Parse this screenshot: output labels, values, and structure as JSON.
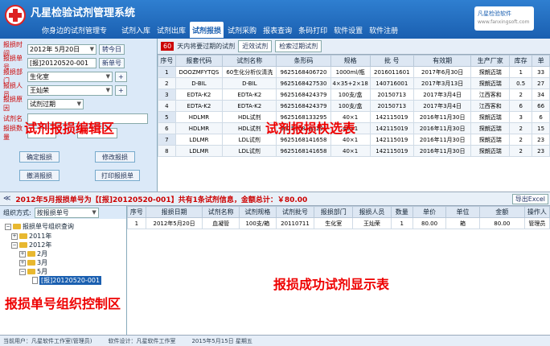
{
  "header": {
    "title": "凡星检验试剂管理系统",
    "subtitle": "你身边的试剂管理专",
    "nav": [
      "试剂入库",
      "试剂出库",
      "试剂报损",
      "试剂采购",
      "报表查询",
      "条码打印",
      "软件设置",
      "软件注册"
    ],
    "active_index": 2,
    "brand_line1": "凡星检验软件",
    "brand_line2": "www.fanxingsoft.com"
  },
  "edit_form": {
    "date_label": "报损时间",
    "date_value": "2012年 5月20日",
    "today_btn": "转今日",
    "number_label": "报损单号",
    "number_value": "[报]20120520-001",
    "new_btn": "新单号",
    "dept_label": "报损部门",
    "dept_value": "生化室",
    "person_label": "报损人员",
    "person_value": "王灿荣",
    "reason_label": "报损原因",
    "reason_value": "试剂过期",
    "item_label": "试剂名",
    "qty_label": "报损数量",
    "confirm_btn": "确定报损",
    "modify_btn": "修改报损",
    "cancel_btn": "撤消报损",
    "print_btn": "打印报损单"
  },
  "quick": {
    "badge": "60",
    "hint": "天内将要过期的试剂",
    "recent_btn": "近效试剂",
    "expired_btn": "检索过期试剂",
    "columns": [
      "序号",
      "报套代码",
      "试剂名称",
      "条形码",
      "规格",
      "批 号",
      "有效期",
      "生产厂家",
      "库存",
      "单"
    ],
    "rows": [
      [
        "1",
        "DOOZMFYTQS",
        "60生化分析仪清洗",
        "9625168406720",
        "1000ml/瓶",
        "2016011601",
        "2017年6月30日",
        "探朗迈瑞",
        "1",
        "33"
      ],
      [
        "2",
        "D-BIL",
        "D-BIL",
        "9625168427530",
        "4×35+2×18",
        "140716001",
        "2017年3月13日",
        "探朗迈瑞",
        "0.5",
        "27"
      ],
      [
        "3",
        "EDTA-K2",
        "EDTA-K2",
        "9625168424379",
        "100支/盒",
        "20150713",
        "2017年3月4日",
        "江西客和",
        "2",
        "34"
      ],
      [
        "4",
        "EDTA-K2",
        "EDTA-K2",
        "9625168424379",
        "100支/盒",
        "20150713",
        "2017年3月4日",
        "江西客和",
        "6",
        "66"
      ],
      [
        "5",
        "HDLMR",
        "HDL试剂",
        "9625168133295",
        "40×1",
        "142115019",
        "2016年11月30日",
        "探朗迈瑞",
        "3",
        "6"
      ],
      [
        "6",
        "HDLMR",
        "HDL试剂",
        "9625168133295",
        "40×1",
        "142115019",
        "2016年11月30日",
        "探朗迈瑞",
        "2",
        "15"
      ],
      [
        "7",
        "LDLMR",
        "LDL试剂",
        "9625168141658",
        "40×1",
        "142115019",
        "2016年11月30日",
        "探朗迈瑞",
        "2",
        "23"
      ],
      [
        "8",
        "LDLMR",
        "LDL试剂",
        "9625168141658",
        "40×1",
        "142115019",
        "2016年11月30日",
        "探朗迈瑞",
        "2",
        "23"
      ]
    ]
  },
  "info_bar": {
    "collapse": "≪",
    "text": "2012年5月报损单号为【[报]20120520-001】共有1条试剂信息，金额总计：￥80.00",
    "export_btn": "导出Excel"
  },
  "tree": {
    "mode_label": "组织方式:",
    "mode_value": "按报损单号",
    "root": "报损单号组织查询",
    "y2011": "2011年",
    "y2012": "2012年",
    "m2": "2月",
    "m3": "3月",
    "m5": "5月",
    "selected": "[报]20120520-001"
  },
  "result": {
    "columns": [
      "序号",
      "报损日期",
      "试剂名称",
      "试剂规格",
      "试剂批号",
      "报损部门",
      "报损人员",
      "数量",
      "单价",
      "单位",
      "金额",
      "操作人"
    ],
    "rows": [
      [
        "1",
        "2012年5月20日",
        "血凝管",
        "100支/箱",
        "20110711",
        "生化室",
        "王灿荣",
        "1",
        "80.00",
        "箱",
        "80.00",
        "管理员"
      ]
    ]
  },
  "status": {
    "left": "当前用户：凡星软件工作室(管理员)",
    "middle": "软件设计：凡星软件工作室 ",
    "right": "2015年5月15日 星期五"
  },
  "annotations": {
    "edit": "试剂报损编辑区",
    "quick": "试剂报损快选表",
    "tree": "报损单号组织控制区",
    "result": "报损成功试剂显示表"
  },
  "colors": {
    "header": "#1a5fb0",
    "annotation": "#e00000",
    "info_text": "#cc0000"
  }
}
